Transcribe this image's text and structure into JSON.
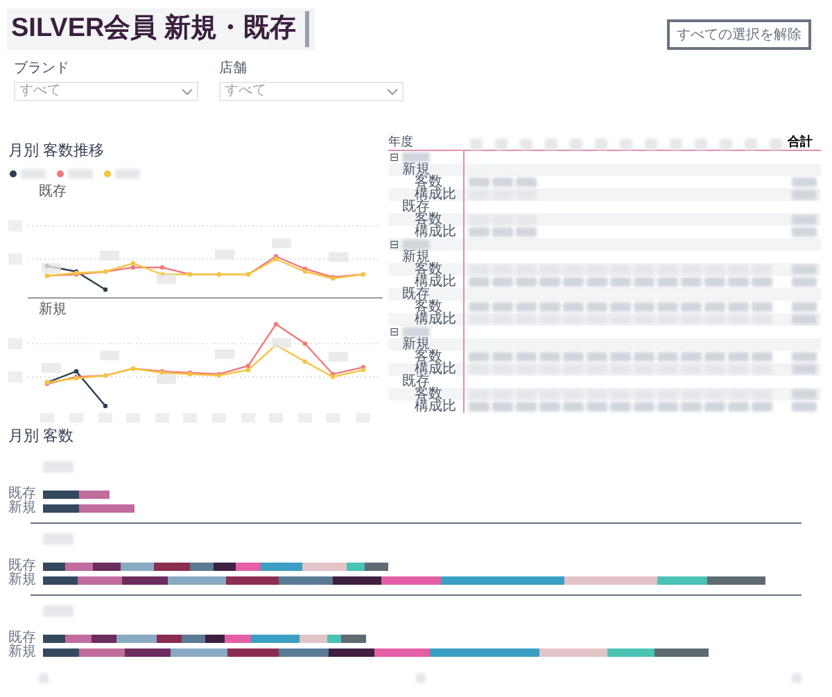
{
  "title": "SILVER会員 新規・既存",
  "clear_button": "すべての選択を解除",
  "filters": [
    {
      "label": "ブランド",
      "value": "すべて"
    },
    {
      "label": "店舗",
      "value": "すべて"
    }
  ],
  "line_chart": {
    "title": "月別 客数推移",
    "legend": [
      {
        "color": "#2d3e50"
      },
      {
        "color": "#f07b7b"
      },
      {
        "color": "#f5c542"
      }
    ],
    "panels": [
      {
        "label": "既存"
      },
      {
        "label": "新規"
      }
    ]
  },
  "matrix": {
    "corner": "年度",
    "total": "合計",
    "groups": [
      {
        "toggle": "⊟",
        "expanded": true,
        "children": [
          {
            "label": "新規",
            "measures": [
              "客数",
              "構成比"
            ]
          },
          {
            "label": "既存",
            "measures": [
              "客数",
              "構成比"
            ]
          }
        ]
      },
      {
        "toggle": "⊟",
        "expanded": true,
        "children": [
          {
            "label": "新規",
            "measures": [
              "客数",
              "構成比"
            ]
          },
          {
            "label": "既存",
            "measures": [
              "客数",
              "構成比"
            ]
          }
        ]
      },
      {
        "toggle": "⊟",
        "expanded": true,
        "children": [
          {
            "label": "新規",
            "measures": [
              "客数",
              "構成比"
            ]
          },
          {
            "label": "既存",
            "measures": [
              "客数",
              "構成比"
            ]
          }
        ]
      }
    ]
  },
  "bar_chart": {
    "title": "月別 客数",
    "panels": [
      {
        "rows": [
          {
            "label": "既存"
          },
          {
            "label": "新規"
          }
        ]
      },
      {
        "rows": [
          {
            "label": "既存"
          },
          {
            "label": "新規"
          }
        ]
      },
      {
        "rows": [
          {
            "label": "既存"
          },
          {
            "label": "新規"
          }
        ]
      }
    ]
  }
}
